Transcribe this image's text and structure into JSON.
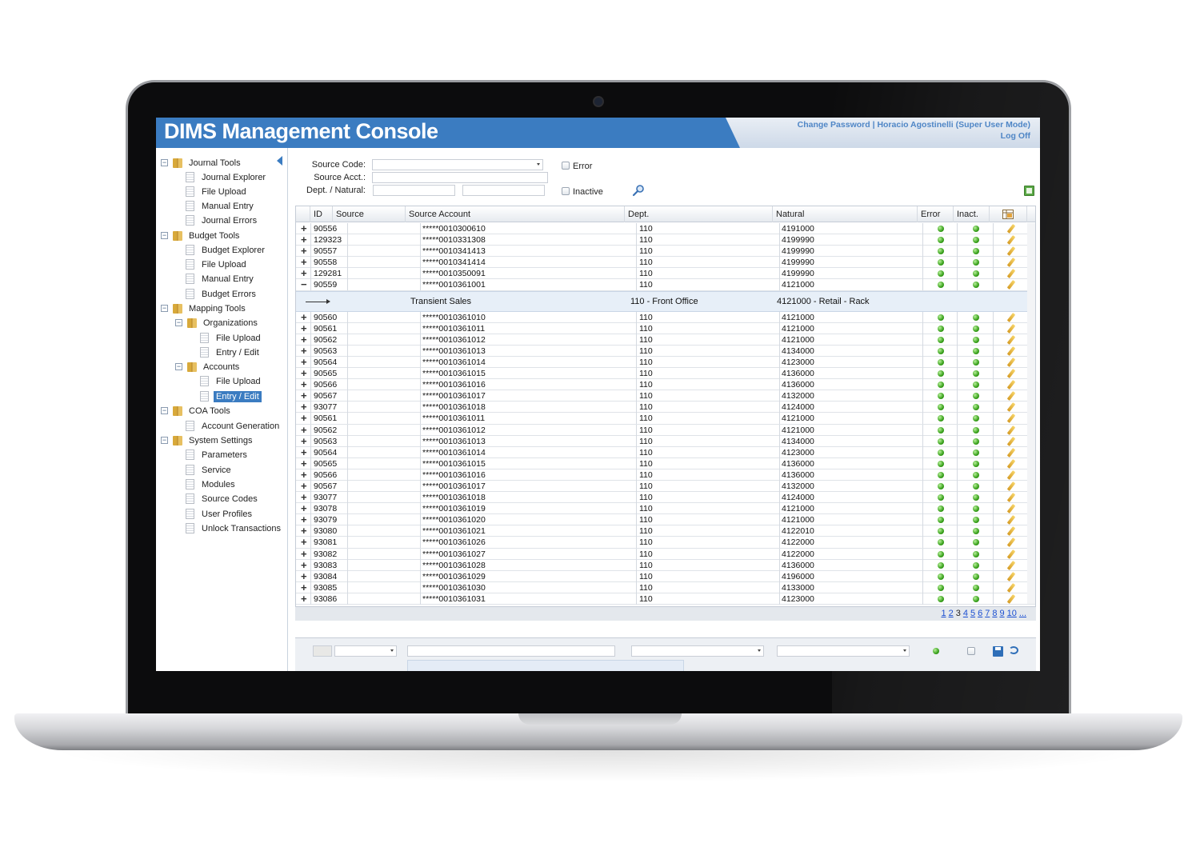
{
  "header": {
    "title": "DIMS Management Console",
    "change_password": "Change Password",
    "separator": " | ",
    "user": "Horacio Agostinelli (Super User Mode)",
    "logoff": "Log Off"
  },
  "sidebar": {
    "journal_tools": "Journal Tools",
    "journal_explorer": "Journal Explorer",
    "journal_file_upload": "File Upload",
    "journal_manual_entry": "Manual Entry",
    "journal_errors": "Journal Errors",
    "budget_tools": "Budget Tools",
    "budget_explorer": "Budget Explorer",
    "budget_file_upload": "File Upload",
    "budget_manual_entry": "Manual Entry",
    "budget_errors": "Budget Errors",
    "mapping_tools": "Mapping Tools",
    "organizations": "Organizations",
    "org_file_upload": "File Upload",
    "org_entry_edit": "Entry / Edit",
    "accounts": "Accounts",
    "acc_file_upload": "File Upload",
    "acc_entry_edit": "Entry / Edit",
    "coa_tools": "COA Tools",
    "account_generation": "Account Generation",
    "system_settings": "System Settings",
    "parameters": "Parameters",
    "service": "Service",
    "modules": "Modules",
    "source_codes": "Source Codes",
    "user_profiles": "User Profiles",
    "unlock_transactions": "Unlock Transactions"
  },
  "filters": {
    "source_code_label": "Source Code:",
    "source_acct_label": "Source Acct.:",
    "dept_natural_label": "Dept. / Natural:",
    "error_label": "Error",
    "inactive_label": "Inactive"
  },
  "grid": {
    "columns": [
      "ID",
      "Source",
      "Source Account",
      "Dept.",
      "Natural",
      "Error",
      "Inact."
    ],
    "rows_top": [
      {
        "id": "90556",
        "account": "*****0010300610",
        "dept": "110",
        "natural": "4191000"
      },
      {
        "id": "129323",
        "account": "*****0010331308",
        "dept": "110",
        "natural": "4199990"
      },
      {
        "id": "90557",
        "account": "*****0010341413",
        "dept": "110",
        "natural": "4199990"
      },
      {
        "id": "90558",
        "account": "*****0010341414",
        "dept": "110",
        "natural": "4199990"
      },
      {
        "id": "129281",
        "account": "*****0010350091",
        "dept": "110",
        "natural": "4199990"
      },
      {
        "id": "90559",
        "account": "*****0010361001",
        "dept": "110",
        "natural": "4121000"
      }
    ],
    "detail": {
      "source": "Transient Sales",
      "dept": "110 - Front Office",
      "natural": "4121000 - Retail - Rack"
    },
    "rows_bottom": [
      {
        "id": "90560",
        "account": "*****0010361010",
        "dept": "110",
        "natural": "4121000"
      },
      {
        "id": "90561",
        "account": "*****0010361011",
        "dept": "110",
        "natural": "4121000"
      },
      {
        "id": "90562",
        "account": "*****0010361012",
        "dept": "110",
        "natural": "4121000"
      },
      {
        "id": "90563",
        "account": "*****0010361013",
        "dept": "110",
        "natural": "4134000"
      },
      {
        "id": "90564",
        "account": "*****0010361014",
        "dept": "110",
        "natural": "4123000"
      },
      {
        "id": "90565",
        "account": "*****0010361015",
        "dept": "110",
        "natural": "4136000"
      },
      {
        "id": "90566",
        "account": "*****0010361016",
        "dept": "110",
        "natural": "4136000"
      },
      {
        "id": "90567",
        "account": "*****0010361017",
        "dept": "110",
        "natural": "4132000"
      },
      {
        "id": "93077",
        "account": "*****0010361018",
        "dept": "110",
        "natural": "4124000"
      },
      {
        "id": "90561",
        "account": "*****0010361011",
        "dept": "110",
        "natural": "4121000"
      },
      {
        "id": "90562",
        "account": "*****0010361012",
        "dept": "110",
        "natural": "4121000"
      },
      {
        "id": "90563",
        "account": "*****0010361013",
        "dept": "110",
        "natural": "4134000"
      },
      {
        "id": "90564",
        "account": "*****0010361014",
        "dept": "110",
        "natural": "4123000"
      },
      {
        "id": "90565",
        "account": "*****0010361015",
        "dept": "110",
        "natural": "4136000"
      },
      {
        "id": "90566",
        "account": "*****0010361016",
        "dept": "110",
        "natural": "4136000"
      },
      {
        "id": "90567",
        "account": "*****0010361017",
        "dept": "110",
        "natural": "4132000"
      },
      {
        "id": "93077",
        "account": "*****0010361018",
        "dept": "110",
        "natural": "4124000"
      },
      {
        "id": "93078",
        "account": "*****0010361019",
        "dept": "110",
        "natural": "4121000"
      },
      {
        "id": "93079",
        "account": "*****0010361020",
        "dept": "110",
        "natural": "4121000"
      },
      {
        "id": "93080",
        "account": "*****0010361021",
        "dept": "110",
        "natural": "4122010"
      },
      {
        "id": "93081",
        "account": "*****0010361026",
        "dept": "110",
        "natural": "4122000"
      },
      {
        "id": "93082",
        "account": "*****0010361027",
        "dept": "110",
        "natural": "4122000"
      },
      {
        "id": "93083",
        "account": "*****0010361028",
        "dept": "110",
        "natural": "4136000"
      },
      {
        "id": "93084",
        "account": "*****0010361029",
        "dept": "110",
        "natural": "4196000"
      },
      {
        "id": "93085",
        "account": "*****0010361030",
        "dept": "110",
        "natural": "4133000"
      },
      {
        "id": "93086",
        "account": "*****0010361031",
        "dept": "110",
        "natural": "4123000"
      }
    ]
  },
  "pager": {
    "pages": [
      "1",
      "2",
      "3",
      "4",
      "5",
      "6",
      "7",
      "8",
      "9",
      "10",
      "..."
    ],
    "current": "3"
  },
  "colors": {
    "header_blue": "#3b7cc1",
    "status_green": "#38a11b",
    "link_blue": "#1b4fd1"
  }
}
